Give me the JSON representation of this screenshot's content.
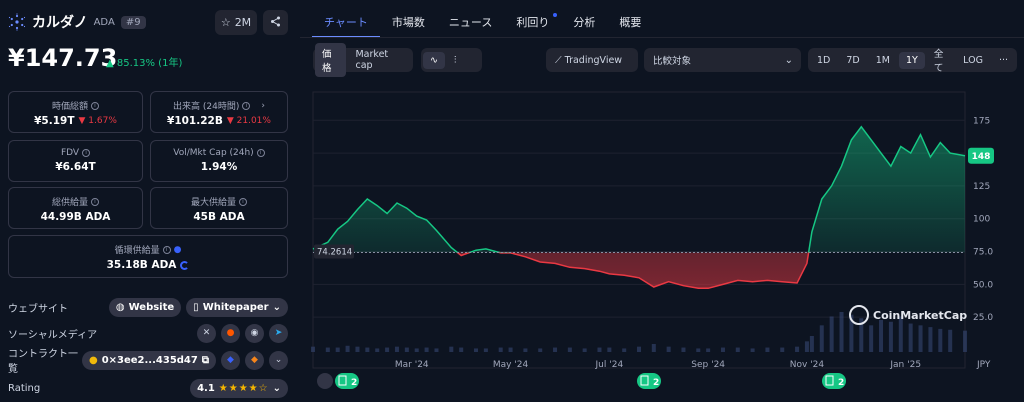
{
  "coin": {
    "name": "カルダノ",
    "symbol": "ADA",
    "rank": "#9"
  },
  "header": {
    "star_count": "2M"
  },
  "price": {
    "value": "¥147.73",
    "change": "85.13% (1年)"
  },
  "stats": {
    "market_cap": {
      "label": "時価総額",
      "value": "¥5.19T",
      "change": "1.67%"
    },
    "volume": {
      "label": "出来高 (24時間)",
      "value": "¥101.22B",
      "change": "21.01%"
    },
    "fdv": {
      "label": "FDV",
      "value": "¥6.64T"
    },
    "vol_mcap": {
      "label": "Vol/Mkt Cap (24h)",
      "value": "1.94%"
    },
    "total_supply": {
      "label": "総供給量",
      "value": "44.99B ADA"
    },
    "max_supply": {
      "label": "最大供給量",
      "value": "45B ADA"
    },
    "circulating": {
      "label": "循環供給量",
      "value": "35.18B ADA"
    }
  },
  "links": {
    "website_label": "ウェブサイト",
    "website_btn": "Website",
    "whitepaper_btn": "Whitepaper",
    "social_label": "ソーシャルメディア",
    "contract_label": "コントラクト一覧",
    "contract_addr": "0×3ee2...435d47",
    "rating_label": "Rating",
    "rating_value": "4.1"
  },
  "tabs": [
    "チャート",
    "市場数",
    "ニュース",
    "利回り",
    "分析",
    "概要"
  ],
  "toolbar": {
    "price_btn": "価格",
    "mcap_btn": "Market cap",
    "tradingview": "TradingView",
    "compare_placeholder": "比較対象",
    "ranges": [
      "1D",
      "7D",
      "1M",
      "1Y",
      "全て"
    ],
    "log": "LOG",
    "more": "···"
  },
  "chart_data": {
    "type": "area",
    "currency": "JPY",
    "baseline": 74.2614,
    "baseline_label": "74.2614",
    "current_label": "148",
    "ylim": [
      0,
      195
    ],
    "yticks": [
      25.0,
      50.0,
      75.0,
      100,
      125,
      150,
      175
    ],
    "ytick_labels": [
      "25.0",
      "50.0",
      "75.0",
      "100",
      "125",
      "",
      "175"
    ],
    "xtick_labels": [
      "Mar '24",
      "May '24",
      "Jul '24",
      "Sep '24",
      "Nov '24",
      "Jan '25"
    ],
    "xtick_months": [
      2,
      4,
      6,
      8,
      10,
      12
    ],
    "x_months": [
      0.0,
      0.3,
      0.5,
      0.7,
      0.9,
      1.1,
      1.3,
      1.5,
      1.7,
      1.9,
      2.1,
      2.3,
      2.5,
      2.8,
      3.0,
      3.3,
      3.5,
      3.8,
      4.0,
      4.3,
      4.6,
      4.9,
      5.2,
      5.5,
      5.8,
      6.0,
      6.3,
      6.6,
      6.9,
      7.2,
      7.5,
      7.8,
      8.0,
      8.3,
      8.6,
      8.9,
      9.2,
      9.5,
      9.8,
      10.0,
      10.1,
      10.3,
      10.5,
      10.7,
      10.9,
      11.1,
      11.3,
      11.5,
      11.7,
      11.9,
      12.1,
      12.3,
      12.5,
      12.7,
      12.9,
      13.2
    ],
    "values": [
      77,
      82,
      92,
      98,
      107,
      115,
      110,
      104,
      112,
      108,
      102,
      99,
      91,
      78,
      72,
      76,
      77,
      74,
      74,
      71,
      67,
      66,
      63,
      62,
      60,
      58,
      57,
      55,
      48,
      52,
      49,
      47,
      47,
      50,
      53,
      52,
      53,
      52,
      51,
      66,
      90,
      115,
      125,
      140,
      160,
      170,
      160,
      150,
      140,
      155,
      150,
      164,
      147,
      158,
      150,
      148
    ],
    "volume_note": "volume bars (relative)",
    "volume": [
      6,
      5,
      5,
      7,
      6,
      5,
      4,
      5,
      6,
      5,
      4,
      5,
      4,
      6,
      5,
      4,
      4,
      5,
      5,
      4,
      4,
      5,
      5,
      4,
      5,
      5,
      4,
      6,
      9,
      6,
      5,
      4,
      4,
      5,
      5,
      4,
      5,
      5,
      6,
      12,
      18,
      30,
      40,
      45,
      42,
      38,
      30,
      36,
      34,
      40,
      32,
      30,
      28,
      26,
      25,
      24
    ],
    "watermark": "CoinMarketCap",
    "event_badges": [
      {
        "count": "2"
      },
      {
        "count": "2"
      },
      {
        "count": "2"
      }
    ]
  }
}
